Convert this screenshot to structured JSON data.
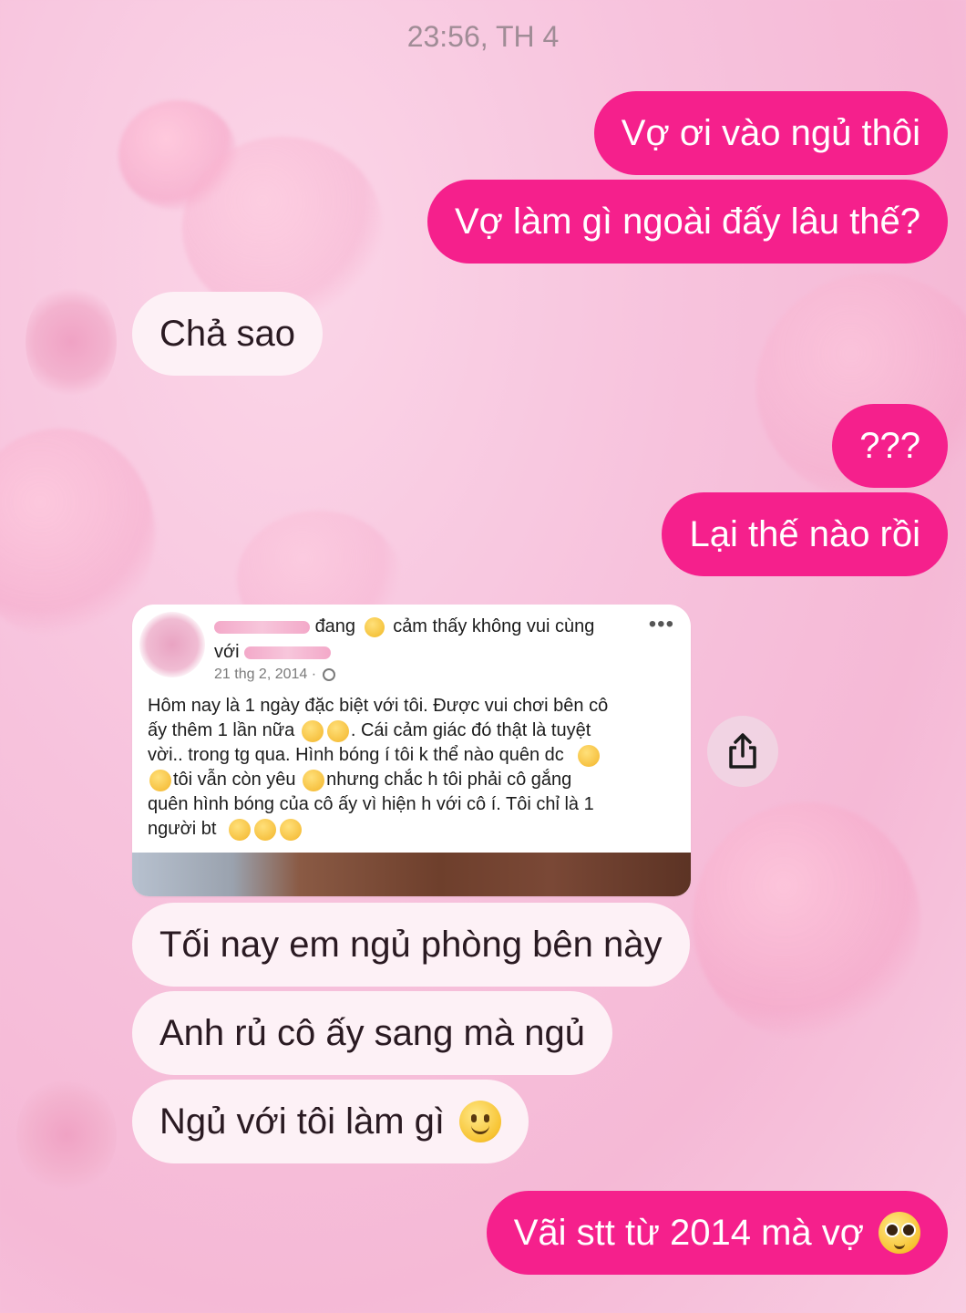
{
  "header": {
    "timestamp": "23:56, TH 4"
  },
  "messages": {
    "m1": "Vợ ơi vào ngủ thôi",
    "m2": "Vợ làm gì ngoài đấy lâu thế?",
    "m3": "Chả sao",
    "m4": "???",
    "m5": "Lại thế nào rồi",
    "m6": "Tối nay em ngủ phòng bên này",
    "m7": "Anh rủ cô ấy sang mà ngủ",
    "m8": "Ngủ với tôi làm gì",
    "m9": "Vãi stt từ 2014 mà vợ"
  },
  "shared_post": {
    "feeling_prefix": "đang",
    "feeling_text": "cảm thấy không vui cùng",
    "with_prefix": "với",
    "date": "21 thg 2, 2014 ·",
    "menu": "•••",
    "body_line1": "Hôm nay là 1 ngày đặc biệt với tôi. Được vui chơi bên cô",
    "body_line2a": "ấy  thêm 1 lần nữa",
    "body_line2b": ". Cái cảm giác đó thật là tuyệt",
    "body_line3": "vời..  trong tg  qua. Hình bóng í tôi k thể nào quên dc",
    "body_line4a": "tôi vẫn còn yêu",
    "body_line4b": "nhưng chắc h tôi phải cô gắng",
    "body_line5": "quên  hình bóng của cô ấy vì hiện h với cô í. Tôi chỉ là 1",
    "body_line6": "người bt"
  },
  "icons": {
    "share": "share-icon",
    "smile": "slightly-smiling-face-icon",
    "plead": "pleading-face-icon"
  },
  "colors": {
    "outgoing_bubble": "#f5208c",
    "incoming_bubble": "#fdf1f6",
    "background": "#f7c3dd"
  }
}
